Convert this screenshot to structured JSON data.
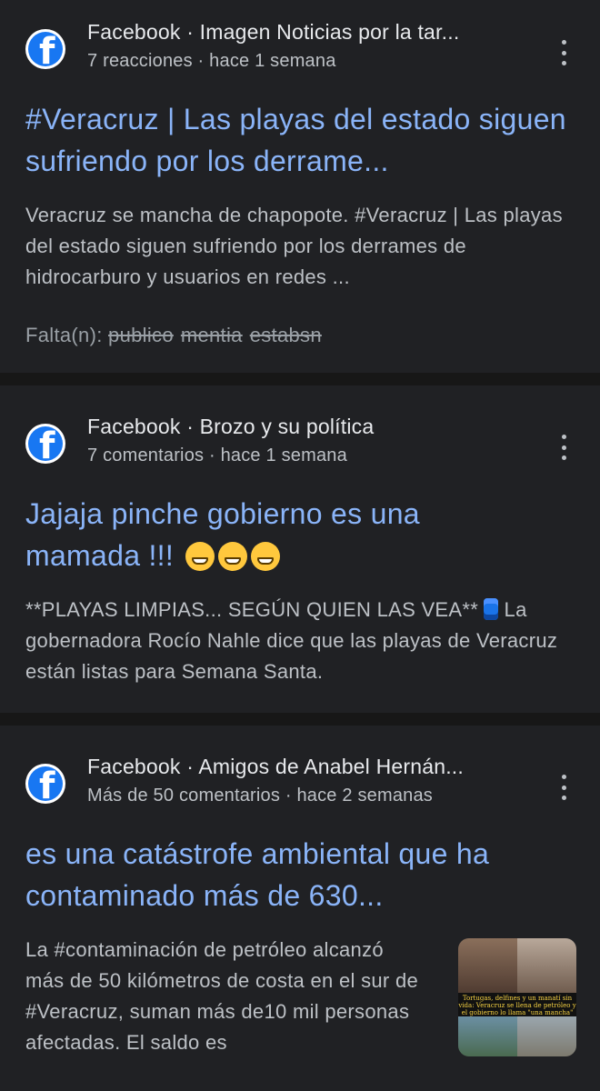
{
  "results": [
    {
      "source": "Facebook · Imagen Noticias por la tar...",
      "meta": "7 reacciones · hace 1 semana",
      "title": "#Veracruz | Las playas del estado siguen sufriendo por los derrame...",
      "snippet": "Veracruz se mancha de chapopote. #Veracruz | Las playas del estado siguen sufriendo por los derrames de hidrocarburo y usuarios en redes ...",
      "missing_label": "Falta(n):",
      "missing_words": [
        "publico",
        "mentia",
        "estabsn"
      ]
    },
    {
      "source": "Facebook · Brozo y su política",
      "meta": "7 comentarios · hace 1 semana",
      "title": "Jajaja pinche gobierno es una mamada !!!",
      "snippet_line1": "**PLAYAS LIMPIAS... SEGÚN QUIEN LAS VEA**",
      "snippet_rest": "La gobernadora Rocío Nahle dice que las playas de Veracruz están listas para Semana Santa."
    },
    {
      "source": "Facebook · Amigos de Anabel Hernán...",
      "meta": "Más de 50 comentarios · hace 2 semanas",
      "title": "es una catástrofe ambiental que ha contaminado más de 630...",
      "snippet": "La #contaminación de petróleo alcanzó más de 50 kilómetros de costa en el sur de #Veracruz, suman más de10 mil personas afectadas. El saldo es",
      "thumbnail_caption": "Tortugas, delfines y un manatí sin vida: Veracruz se llena de petróleo y el gobierno lo llama \"una mancha\""
    }
  ],
  "icons": {
    "source_logo": "facebook-icon",
    "menu": "more-vert-icon"
  }
}
